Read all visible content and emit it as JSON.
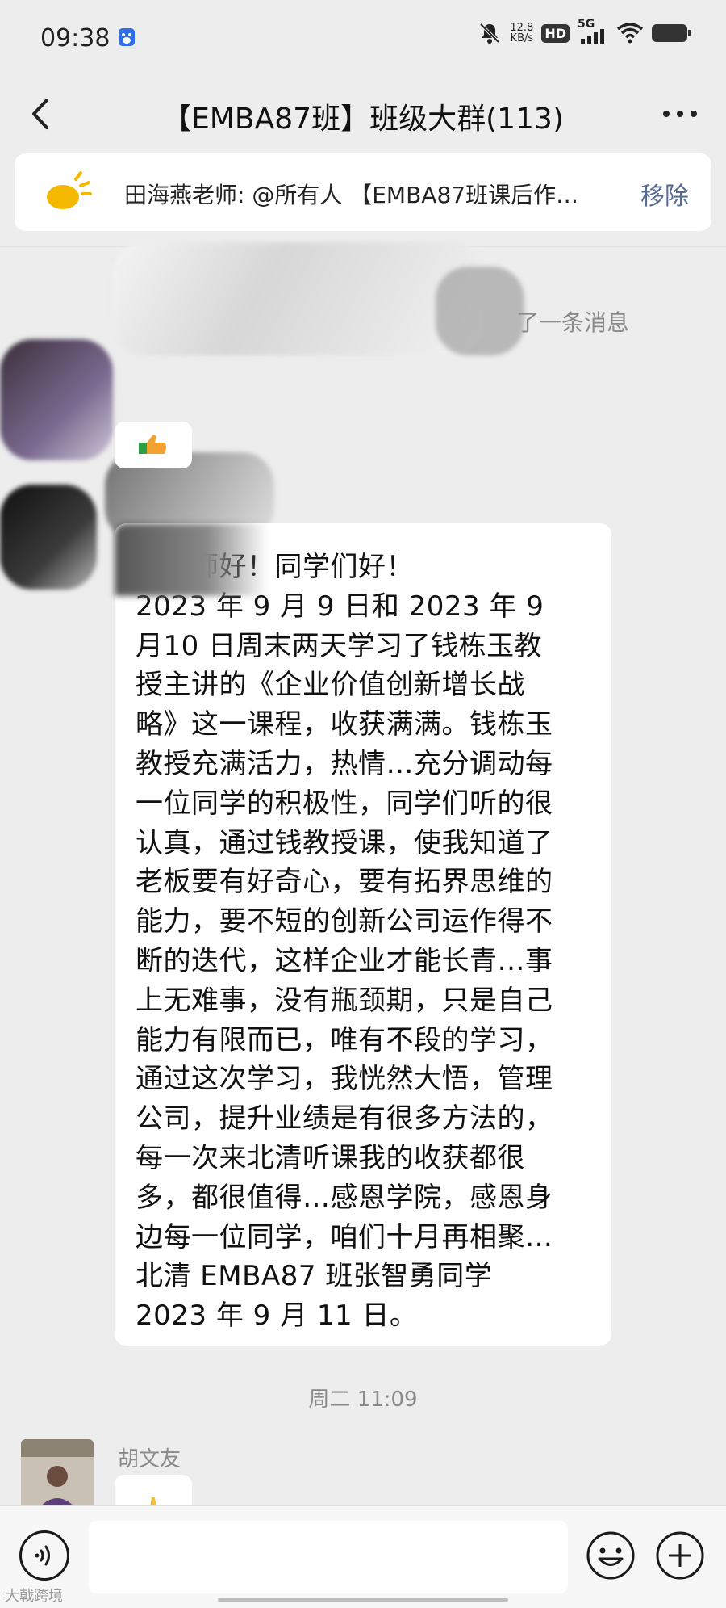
{
  "status_bar": {
    "time": "09:38",
    "net_speed_value": "12.8",
    "net_speed_unit": "KB/s",
    "hd": "HD",
    "network": "5G",
    "icons": [
      "baidu-app-icon",
      "mute-icon",
      "signal-icon",
      "wifi-icon",
      "battery-icon"
    ]
  },
  "nav": {
    "title": "【EMBA87班】班级大群(113)",
    "icons": [
      "back-arrow-icon",
      "more-dots-icon"
    ]
  },
  "notice": {
    "text": "田海燕老师: @所有人 【EMBA87班课后作…",
    "remove_label": "移除",
    "icon": "announcement-horn-icon"
  },
  "chat": {
    "system_message": "了一条消息",
    "message": {
      "lines": [
        "白老师好！同学们好！",
        "2023 年 9 月 9 日和 2023 年 9",
        "月10 日周末两天学习了钱栋玉教",
        "授主讲的《企业价值创新增长战",
        "略》这一课程，收获满满。钱栋玉",
        "教授充满活力，热情…充分调动每",
        "一位同学的积极性，同学们听的很",
        "认真，通过钱教授课，使我知道了",
        "老板要有好奇心，要有拓界思维的",
        "能力，要不短的创新公司运作得不",
        "断的迭代，这样企业才能长青…事",
        "上无难事，没有瓶颈期，只是自己",
        "能力有限而已，唯有不段的学习，",
        "通过这次学习，我恍然大悟，管理",
        "公司，提升业绩是有很多方法的，",
        "每一次来北清听课我的收获都很",
        "多，都很值得…感恩学院，感恩身",
        "边每一位同学，咱们十月再相聚…",
        "北清 EMBA87 班张智勇同学",
        "2023 年 9 月 11 日。"
      ]
    },
    "timestamp": "周二 11:09",
    "sender_name": "胡文友"
  },
  "input": {
    "icons": [
      "voice-icon",
      "emoji-icon",
      "plus-icon"
    ]
  },
  "watermark": "大戟跨境",
  "colors": {
    "background": "#ededed",
    "bubble": "#ffffff",
    "link": "#576b95",
    "muted_text": "#8a8a8a",
    "notice_icon": "#f5b800"
  }
}
